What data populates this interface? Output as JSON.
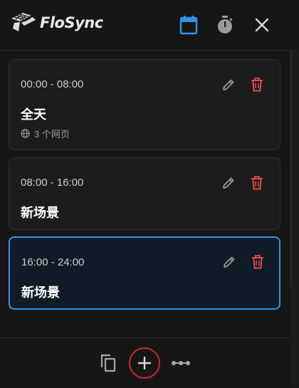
{
  "header": {
    "app_name": "FloSync",
    "icons": [
      "calendar-icon",
      "timer-icon",
      "close-icon"
    ]
  },
  "scenes": [
    {
      "time": "00:00 - 08:00",
      "name": "全天",
      "meta": "3 个网页",
      "active": false
    },
    {
      "time": "08:00 - 16:00",
      "name": "新场景",
      "active": false
    },
    {
      "time": "16:00 - 24:00",
      "name": "新场景",
      "active": true
    }
  ],
  "footer": {
    "icons": [
      "copy-icon",
      "add-icon",
      "more-icon"
    ]
  },
  "colors": {
    "accent": "#3592e4",
    "danger": "#e5484d",
    "highlight": "#d9262b"
  }
}
